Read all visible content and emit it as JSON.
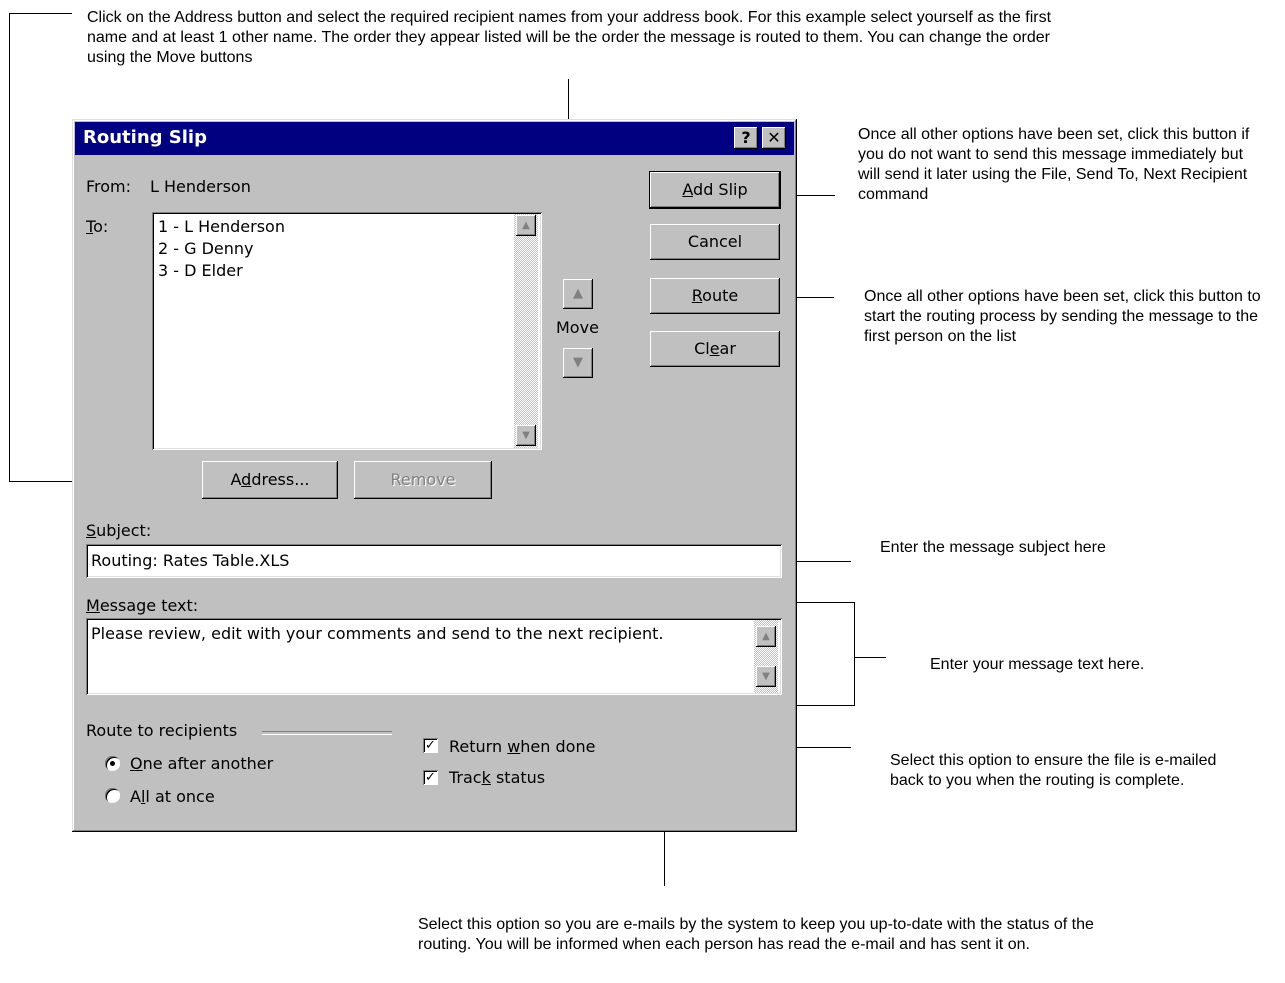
{
  "annotations": {
    "address": "Click on the Address button and select the required recipient names from your address book.  For this example select yourself as the first name and at least 1 other name.  The order they appear listed will be the order the message is routed to them.  You can change the order using the Move buttons",
    "add_slip": "Once all other options have been set, click this button if you do not want to send this message immediately but will send it later using the File, Send To, Next Recipient command",
    "route": "Once all other options have been set, click this button to start the routing process by sending the message to the first person on the list",
    "subject": "Enter the message subject here",
    "message": "Enter your message text here.",
    "return": "Select this option to ensure the file is e-mailed back to you when the routing is complete.",
    "track": "Select this option so you are e-mails by the system to keep you up-to-date with the status of the routing.  You will be informed when each person has read the e-mail and has sent it on."
  },
  "dialog": {
    "title": "Routing Slip",
    "help_button": "?",
    "close_button": "✕",
    "from_label": "From:",
    "from_value": "L Henderson",
    "to_label_pre": "",
    "to_label_key": "T",
    "to_label_post": "o:",
    "recipients": [
      "1 - L Henderson",
      "2 - G Denny",
      "3 - D Elder"
    ],
    "move_label": "Move",
    "address_button": {
      "pre": "A",
      "key": "d",
      "post": "dress..."
    },
    "remove_button": "Remove",
    "subject_label": {
      "key": "S",
      "post": "ubject:"
    },
    "subject_value": "Routing: Rates Table.XLS",
    "message_label": {
      "key": "M",
      "post": "essage text:"
    },
    "message_value": "Please review, edit with your comments and send to the next recipient.",
    "route_group_label": "Route to recipients",
    "option_one": {
      "key": "O",
      "post": "ne after another"
    },
    "option_all": {
      "pre": "A",
      "key": "l",
      "post": "l at once"
    },
    "return_when_done": {
      "pre": "Return ",
      "key": "w",
      "post": "hen done"
    },
    "track_status": {
      "pre": "Trac",
      "key": "k",
      "post": " status"
    },
    "add_slip_button": {
      "key": "A",
      "post": "dd Slip"
    },
    "cancel_button": "Cancel",
    "route_button": {
      "key": "R",
      "post": "oute"
    },
    "clear_button": {
      "pre": "Cl",
      "key": "e",
      "post": "ar"
    }
  }
}
